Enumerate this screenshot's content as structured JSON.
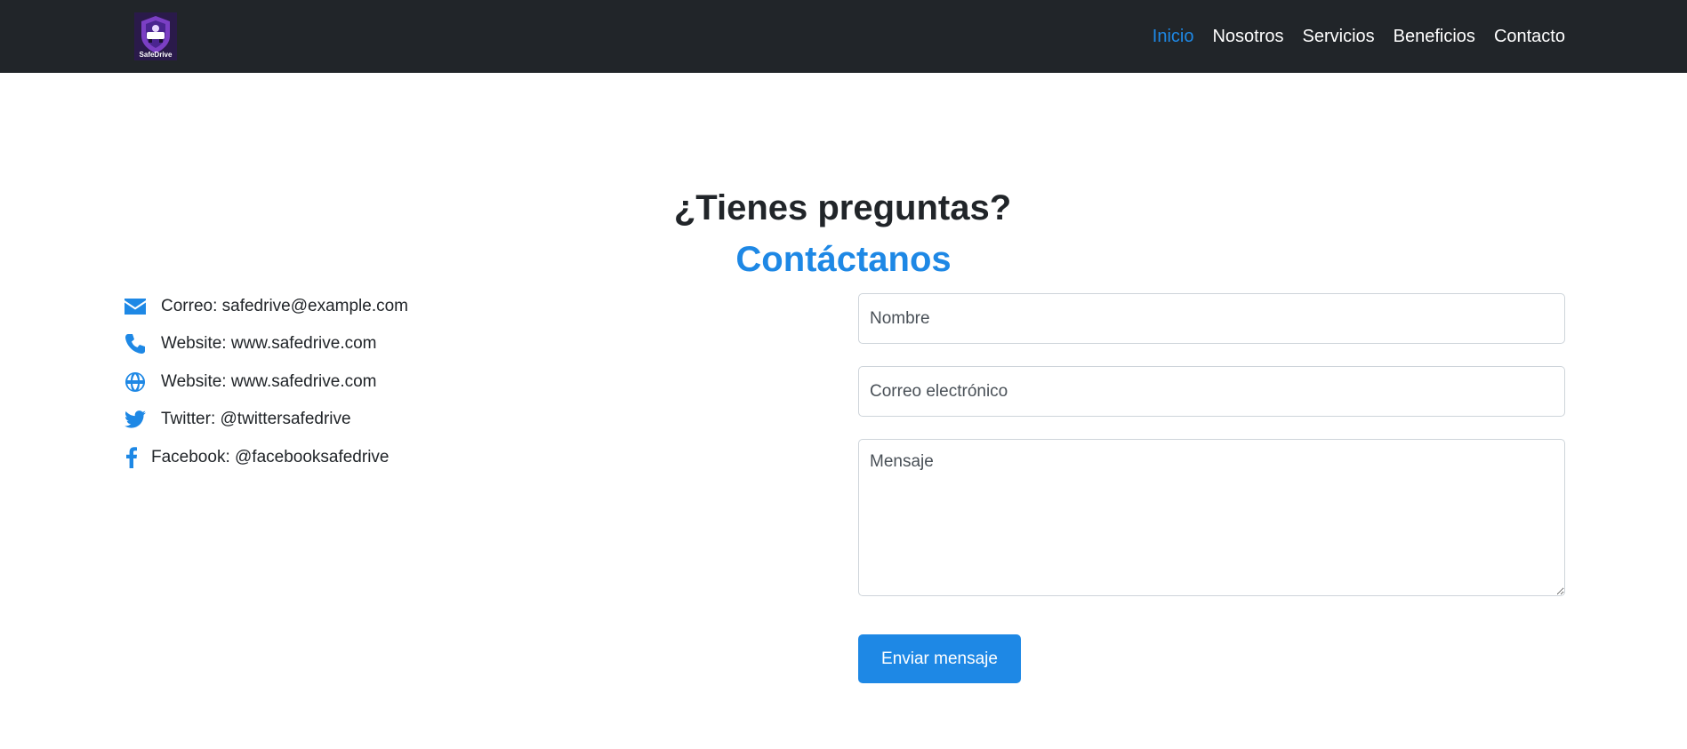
{
  "brand": {
    "logo_text": "SafeDrive",
    "accent_color": "#1e88e5",
    "nav_bg": "#212529"
  },
  "nav": {
    "items": [
      {
        "label": "Inicio",
        "active": true
      },
      {
        "label": "Nosotros",
        "active": false
      },
      {
        "label": "Servicios",
        "active": false
      },
      {
        "label": "Beneficios",
        "active": false
      },
      {
        "label": "Contacto",
        "active": false
      }
    ]
  },
  "section": {
    "title": "¿Tienes preguntas?",
    "subtitle": "Contáctanos"
  },
  "contacts": [
    {
      "icon": "envelope-icon",
      "text": "Correo: safedrive@example.com"
    },
    {
      "icon": "phone-icon",
      "text": "Website: www.safedrive.com"
    },
    {
      "icon": "globe-icon",
      "text": "Website: www.safedrive.com"
    },
    {
      "icon": "twitter-icon",
      "text": "Twitter: @twittersafedrive"
    },
    {
      "icon": "facebook-icon",
      "text": "Facebook: @facebooksafedrive"
    }
  ],
  "form": {
    "name_placeholder": "Nombre",
    "email_placeholder": "Correo electrónico",
    "message_placeholder": "Mensaje",
    "submit_label": "Enviar mensaje"
  }
}
